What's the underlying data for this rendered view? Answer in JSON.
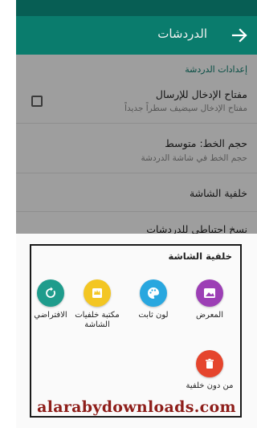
{
  "app_bar": {
    "title": "الدردشات"
  },
  "settings": {
    "section_label": "إعدادات الدردشة",
    "enter_key": {
      "title": "مفتاح الإدخال للإرسال",
      "subtitle": "مفتاح الإدخال سيضيف سطراً جديداً",
      "checked": false
    },
    "font_size": {
      "title": "حجم الخط: متوسط",
      "subtitle": "حجم الخط في شاشة الدردشة"
    },
    "wallpaper": {
      "title": "خلفية الشاشة"
    },
    "backup": {
      "title": "نسخ احتياطي للدردشات"
    }
  },
  "sheet": {
    "title": "خلفية الشاشة",
    "options": [
      {
        "label": "المعرض",
        "icon": "gallery-icon",
        "color": "#9c3fb5"
      },
      {
        "label": "لون ثابت",
        "icon": "palette-icon",
        "color": "#29a7df"
      },
      {
        "label": "مكتبة خلفيات الشاشة",
        "icon": "wallpaper-library-icon",
        "color": "#f3c623"
      },
      {
        "label": "الافتراضي",
        "icon": "reset-icon",
        "color": "#1f9c8c"
      },
      {
        "label": "من دون خلفية",
        "icon": "trash-icon",
        "color": "#e5452d"
      }
    ]
  },
  "watermark": "alarabydownloads.com"
}
